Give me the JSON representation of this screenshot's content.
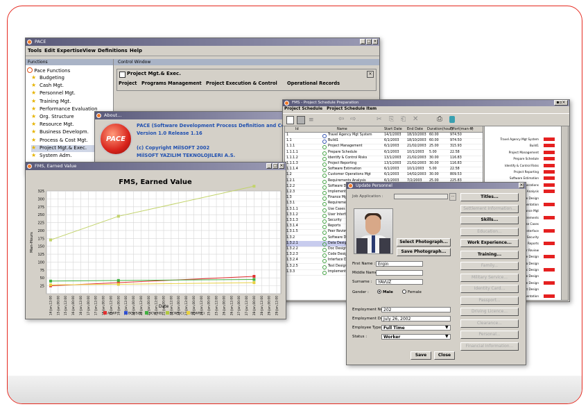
{
  "pace_window": {
    "title": "PACE",
    "menu": [
      "Tools",
      "Edit",
      "Expertise",
      "View",
      "Definitions",
      "Help"
    ],
    "functions_header": "Functions",
    "control_header": "Control Window",
    "functions_root": "Pace Functions",
    "functions": [
      "Budgeting",
      "Cash Mgt.",
      "Personnel Mgt.",
      "Training Mgt.",
      "Performance Evaluation",
      "Org. Structure",
      "Resource Mgt.",
      "Business Developm.",
      "Process & Cost Mgt.",
      "Project Mgt.& Exec.",
      "System Adm."
    ],
    "control_title": "Project Mgt.& Exec.",
    "control_tabs": [
      "Project",
      "Programs Management",
      "Project Execution & Control",
      "Operational Records"
    ]
  },
  "about": {
    "title": "About...",
    "logo_text": "PACE",
    "line1": "PACE (Software Development Process Definition and Control)",
    "line2": "Version 1.0 Release 1.16",
    "line3": "(c) Copyright MilSOFT 2002",
    "line4": "MilSOFT YAZILIM TEKNOLOJILERI A.S."
  },
  "fms": {
    "window_title": "FMS, Earned Value",
    "chart_title": "FMS, Earned Value",
    "y_label": "Man-Hours",
    "x_label": "Date",
    "y_ticks": [
      "325",
      "300",
      "275",
      "250",
      "225",
      "200",
      "175",
      "150",
      "125",
      "100",
      "75",
      "50",
      "25"
    ],
    "x_ticks": [
      "14-Jan,12:00",
      "15-Jan,00:00",
      "15-Jan,12:00",
      "16-Jan,00:00",
      "16-Jan,12:00",
      "17-Jan,00:00",
      "17-Jan,12:00",
      "18-Jan,00:00",
      "18-Jan,12:00",
      "19-Jan,00:00",
      "19-Jan,12:00",
      "20-Jan,00:00",
      "20-Jan,12:00",
      "21-Jan,00:00",
      "21-Jan,12:00",
      "22-Jan,00:00",
      "22-Jan,12:00",
      "23-Jan,00:00",
      "23-Jan,12:00",
      "24-Jan,00:00",
      "24-Jan,12:00",
      "25-Jan,00:00",
      "25-Jan,12:00",
      "26-Jan,00:00",
      "26-Jan,12:00",
      "27-Jan,00:00",
      "27-Jan,12:00",
      "28-Jan,00:00",
      "28-Jan,12:00",
      "29-Jan,00:00",
      "29-Jan,12:00"
    ],
    "legend": [
      {
        "name": "ACWP",
        "color": "#e03030"
      },
      {
        "name": "BCWS(B)",
        "color": "#3050d0"
      },
      {
        "name": "BCWP(B)",
        "color": "#40b040"
      },
      {
        "name": "BCWS(C)",
        "color": "#b0c840"
      },
      {
        "name": "BCWP(C)",
        "color": "#e8d040"
      }
    ]
  },
  "chart_data": {
    "type": "line",
    "title": "FMS, Earned Value",
    "xlabel": "Date",
    "ylabel": "Man-Hours",
    "ylim": [
      0,
      325
    ],
    "x": [
      "14-Jan",
      "19-Jan",
      "28-Jan"
    ],
    "series": [
      {
        "name": "BCWS(C)",
        "values": [
          170,
          245,
          340
        ],
        "color": "#c2d36a"
      },
      {
        "name": "ACWP",
        "values": [
          25,
          35,
          55
        ],
        "color": "#e03030"
      },
      {
        "name": "BCWP(B)",
        "values": [
          40,
          42,
          45
        ],
        "color": "#40b040"
      },
      {
        "name": "BCWP(C)",
        "values": [
          28,
          30,
          35
        ],
        "color": "#e8d040"
      }
    ]
  },
  "schedule": {
    "title": "FMS - Project Schedule Preparation",
    "menu": [
      "Project Schedule",
      "Project Schedule Item"
    ],
    "columns": [
      "Id",
      "Name",
      "Start Date",
      "End Date",
      "Duration(hour)",
      "Effort(man-h)",
      "P"
    ],
    "rows": [
      {
        "id": "1",
        "name": "Travel Agency Mgt System",
        "start": "14/1/2003",
        "end": "18/10/2003",
        "dur": "60.00",
        "eff": "974.50"
      },
      {
        "id": "1.1",
        "name": "Build1",
        "start": "6/1/2003",
        "end": "18/10/2003",
        "dur": "60.00",
        "eff": "974.50"
      },
      {
        "id": "1.1.1",
        "name": "Project Management",
        "start": "6/1/2003",
        "end": "21/02/2003",
        "dur": "25.00",
        "eff": "315.93"
      },
      {
        "id": "1.1.1.1",
        "name": "Prepare Schedule",
        "start": "6/1/2003",
        "end": "10/1/2003",
        "dur": "5.00",
        "eff": "22.58"
      },
      {
        "id": "1.1.1.2",
        "name": "Identify & Control Risks",
        "start": "13/1/2003",
        "end": "21/02/2003",
        "dur": "30.00",
        "eff": "116.83"
      },
      {
        "id": "1.1.1.3",
        "name": "Project Reporting",
        "start": "13/1/2003",
        "end": "21/02/2003",
        "dur": "30.00",
        "eff": "116.83"
      },
      {
        "id": "1.1.1.4",
        "name": "Software Estimation",
        "start": "6/1/2003",
        "end": "10/1/2003",
        "dur": "5.00",
        "eff": "22.58"
      },
      {
        "id": "1.2",
        "name": "Customer Operations Mgt",
        "start": "6/1/2003",
        "end": "14/02/2003",
        "dur": "30.00",
        "eff": "809.53"
      },
      {
        "id": "1.2.1",
        "name": "Requirements Analysis",
        "start": "6/1/2003",
        "end": "7/2/2003",
        "dur": "25.00",
        "eff": "225.83"
      },
      {
        "id": "1.2.2",
        "name": "Software Design",
        "start": "10/2/2003",
        "end": "28/2/2003",
        "dur": "15.00",
        "eff": "90.08"
      },
      {
        "id": "1.2.3",
        "name": "Implementation",
        "start": "3/3/2003",
        "end": "21/03/2003",
        "dur": "15.00",
        "eff": "90.08"
      },
      {
        "id": "1.3",
        "name": "Finance Mgt",
        "start": "",
        "end": "",
        "dur": "",
        "eff": ""
      },
      {
        "id": "1.3.1",
        "name": "Requirements",
        "start": "",
        "end": "",
        "dur": "",
        "eff": ""
      },
      {
        "id": "1.3.1.1",
        "name": "Use Cases",
        "start": "",
        "end": "",
        "dur": "",
        "eff": ""
      },
      {
        "id": "1.3.1.2",
        "name": "User Interface",
        "start": "",
        "end": "",
        "dur": "",
        "eff": ""
      },
      {
        "id": "1.3.1.3",
        "name": "Security",
        "start": "",
        "end": "",
        "dur": "",
        "eff": ""
      },
      {
        "id": "1.3.1.4",
        "name": "Reports",
        "start": "",
        "end": "",
        "dur": "",
        "eff": ""
      },
      {
        "id": "1.3.1.5",
        "name": "Peer Review",
        "start": "",
        "end": "",
        "dur": "",
        "eff": ""
      },
      {
        "id": "1.3.2",
        "name": "Software Design",
        "start": "",
        "end": "",
        "dur": "",
        "eff": ""
      },
      {
        "id": "1.3.2.1",
        "name": "Data Design",
        "start": "",
        "end": "",
        "dur": "",
        "eff": ""
      },
      {
        "id": "1.3.2.2",
        "name": "Doc Design",
        "start": "",
        "end": "",
        "dur": "",
        "eff": ""
      },
      {
        "id": "1.3.2.3",
        "name": "Code Design",
        "start": "",
        "end": "",
        "dur": "",
        "eff": ""
      },
      {
        "id": "1.3.2.4",
        "name": "Interface Design",
        "start": "",
        "end": "",
        "dur": "",
        "eff": ""
      },
      {
        "id": "1.3.2.5",
        "name": "Test Design",
        "start": "",
        "end": "",
        "dur": "",
        "eff": ""
      },
      {
        "id": "1.3.3",
        "name": "Implementation",
        "start": "",
        "end": "",
        "dur": "",
        "eff": ""
      }
    ],
    "gantt_labels": [
      "Travel Agency Mgt System",
      "Build1",
      "Project Management",
      "Prepare Schedule",
      "Identify & Control Risks",
      "Project Reporting",
      "Software Estimation",
      "Customer Operations",
      "Requirements Analysis",
      "Software Design",
      "Implementation",
      "Finance Mgt",
      "Requirements",
      "Use Cases",
      "User Interface",
      "Security",
      "Reports",
      "Peer Review",
      "Software Design",
      "Data Design",
      "Doc Design",
      "Code Design",
      "Interface Design",
      "Test Design",
      "Implementation",
      "Verification"
    ]
  },
  "personnel": {
    "title": "Update Personnel",
    "job_application_label": "Job Application :",
    "select_photo": "Select Photograph...",
    "save_photo": "Save Photograph...",
    "first_name_label": "First Name :",
    "first_name": "Ergin",
    "middle_name_label": "Middle Name :",
    "middle_name": "",
    "surname_label": "Surname :",
    "surname": "YAVUZ",
    "gender_label": "Gender :",
    "gender_male": "Male",
    "gender_female": "Female",
    "employment_no_label": "Employment No :",
    "employment_no": "202",
    "employment_date_label": "Employment Date :",
    "employment_date": "July 26, 2002",
    "employee_type_label": "Employee Type :",
    "employee_type": "Full Time",
    "status_label": "Status :",
    "status": "Worker",
    "save": "Save",
    "close": "Close",
    "side_buttons": [
      {
        "label": "Titles...",
        "enabled": true
      },
      {
        "label": "Settlement Information...",
        "enabled": false
      },
      {
        "label": "Skills...",
        "enabled": true
      },
      {
        "label": "Education...",
        "enabled": false
      },
      {
        "label": "Work Experience...",
        "enabled": true
      },
      {
        "label": "Training...",
        "enabled": true
      },
      {
        "label": "Family...",
        "enabled": false
      },
      {
        "label": "Military Service...",
        "enabled": false
      },
      {
        "label": "Identity Card...",
        "enabled": false
      },
      {
        "label": "Passport...",
        "enabled": false
      },
      {
        "label": "Driving Licence...",
        "enabled": false
      },
      {
        "label": "Clearance...",
        "enabled": false
      },
      {
        "label": "Personal...",
        "enabled": false
      },
      {
        "label": "Financial Information...",
        "enabled": false
      }
    ]
  }
}
